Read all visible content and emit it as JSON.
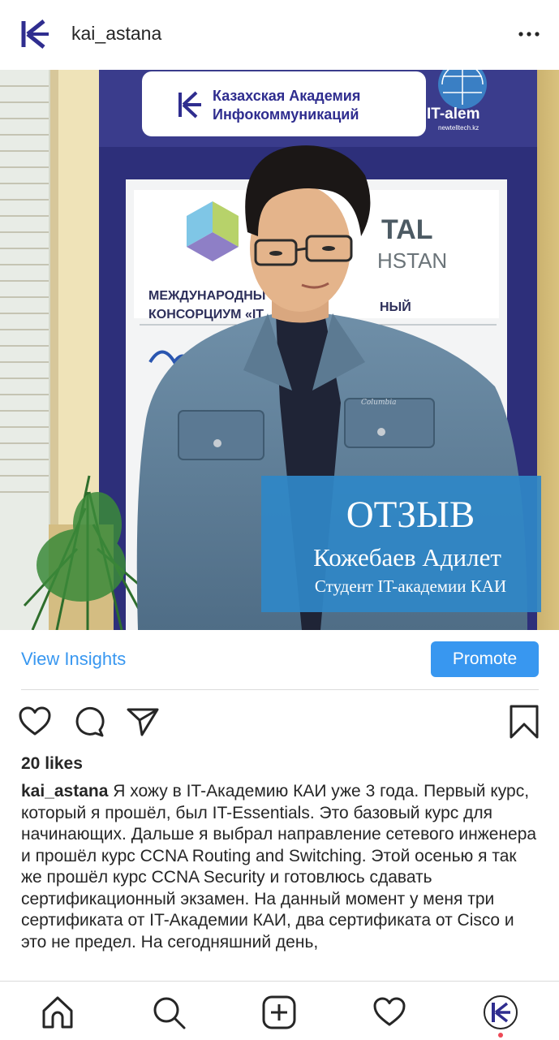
{
  "header": {
    "username": "kai_astana",
    "avatar_icon": "kai-logo-icon",
    "more_icon": "more-dots-icon"
  },
  "post_image": {
    "banner_line1": "Казахская Академия",
    "banner_line2": "Инфокоммуникаций",
    "partner_logo": "IT-alem",
    "partner_url": "newtelltech.kz",
    "poster_fragment1": "МЕЖДУНАРОДНЫ",
    "poster_fragment1b": "НЫЙ",
    "poster_fragment2": "КОНСОРЦИУМ «IT",
    "poster_fragment3": "TAL",
    "poster_fragment4": "HSTAN",
    "overlay_title": "ОТЗЫВ",
    "overlay_name": "Кожебаев Адилет",
    "overlay_role": "Студент IT-академии КАИ",
    "jacket_brand": "Columbia",
    "colors": {
      "overlay_blue": "#2f86c6",
      "banner_navy": "#2d2f7a"
    }
  },
  "insights": {
    "view_insights_label": "View Insights",
    "promote_label": "Promote"
  },
  "actions": {
    "like_icon": "heart-icon",
    "comment_icon": "comment-icon",
    "share_icon": "send-icon",
    "save_icon": "bookmark-icon"
  },
  "likes_text": "20 likes",
  "caption": {
    "username": "kai_astana",
    "text": "Я хожу в IT-Академию КАИ уже 3 года. Первый курс, который я прошёл, был IT-Essentials. Это базовый курс для начинающих. Дальше я выбрал направление сетевого инженера и прошёл курс CCNA Routing and Switching. Этой осенью я так же прошёл курс CCNA Security и готовлюсь сдавать сертификационный экзамен. На данный момент у меня три сертификата от IT-Академии КАИ, два сертификата от Cisco и это не предел. На сегодняшний день,"
  },
  "tabbar": {
    "home_icon": "home-icon",
    "search_icon": "search-icon",
    "add_icon": "add-post-icon",
    "activity_icon": "heart-icon",
    "profile_icon": "profile-avatar-icon"
  },
  "colors": {
    "accent": "#3897f0",
    "notification_dot": "#ed4956"
  }
}
